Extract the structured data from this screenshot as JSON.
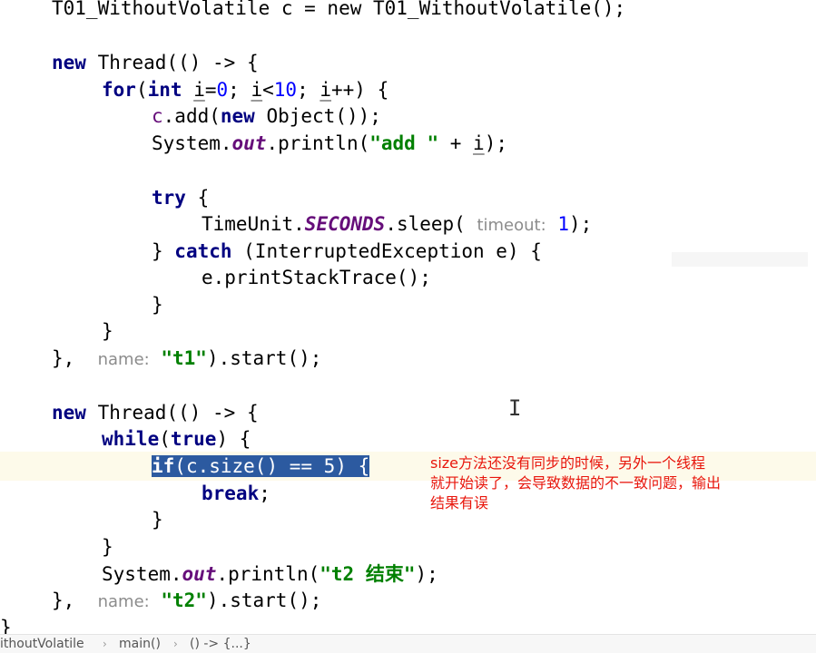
{
  "editor": {
    "line_top_partial": "T01_WithoutVolatile c = new T01_WithoutVolatile();",
    "new_kw": "new",
    "thread": " Thread(() -> {",
    "for_kw": "for",
    "int_kw": "int",
    "for_rest": {
      "a": "(",
      "i1": "i",
      "eq": "=",
      "n0": "0",
      "sc": "; ",
      "i2": "i",
      "lt": "<",
      "n10": "10",
      "sc2": "; ",
      "i3": "i",
      "inc": "++) {"
    },
    "c_var": "c",
    "add_call": ".add(",
    "add_new": "new",
    "add_obj": " Object());",
    "sys": "System.",
    "out": "out",
    "println_open": ".println(",
    "add_str": "\"add \"",
    "plus": " + ",
    "i_var": "i",
    "close": ");",
    "try_kw": "try",
    "brace_open": " {",
    "timeunit": "TimeUnit.",
    "seconds": "SECONDS",
    "sleep": ".sleep( ",
    "timeout_hint": "timeout:",
    "sleep_val": "1",
    "catch_close": "} ",
    "catch_kw": "catch",
    "catch_rest": " (InterruptedException e) {",
    "print_stack": "e.printStackTrace();",
    "rbrace": "}",
    "t1_close_a": "}, ",
    "name_hint": "name:",
    "t1_str": "\"t1\"",
    "start": ").start();",
    "while_kw": "while",
    "paren_open": "(",
    "true_kw": "true",
    "paren_close_brace": ") {",
    "if_kw": "if",
    "if_cond": "(c.size() == ",
    "if_num": "5",
    "if_end": ") {",
    "break_kw": "break",
    "semi": ";",
    "t2_end_str": "\"t2 结束\"",
    "t2_str": "\"t2\""
  },
  "annotation": {
    "lines": [
      "size方法还没有同步的时候，另外一个线程",
      "就开始读了，会导致数据的不一致问题，输出",
      "结果有误"
    ]
  },
  "cursor_glyph": "I",
  "breadcrumb": {
    "items": [
      "ithoutVolatile",
      "main()",
      "() -> {...}"
    ],
    "separator": "›"
  },
  "colors": {
    "keyword": "#000080",
    "number": "#0000ff",
    "string": "#008000",
    "static_field": "#660e7a",
    "selection": "#2c5aa0",
    "annotation_text": "#e8160c"
  }
}
